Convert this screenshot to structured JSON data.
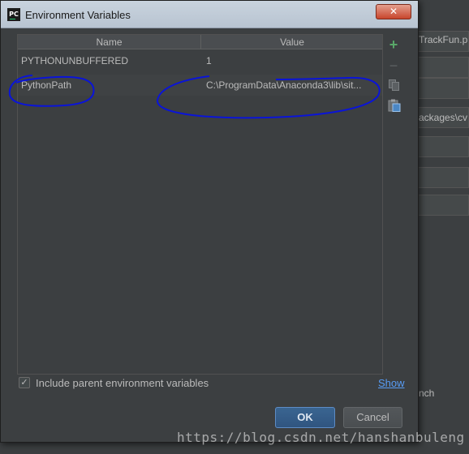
{
  "background_ide": {
    "fragments": [
      "TrackFun.p",
      "ackages\\cv",
      "nch"
    ]
  },
  "dialog": {
    "app_icon": "PC",
    "title": "Environment Variables",
    "close_label": "✕"
  },
  "table": {
    "columns": [
      "Name",
      "Value"
    ],
    "rows": [
      {
        "name": "PYTHONUNBUFFERED",
        "value": "1"
      },
      {
        "name": "PythonPath",
        "value": "C:\\ProgramData\\Anaconda3\\lib\\sit..."
      }
    ]
  },
  "toolbar": {
    "add_icon": "plus-icon",
    "add_label": "+",
    "remove_icon": "minus-icon",
    "remove_label": "−",
    "copy_icon": "copy-icon",
    "paste_icon": "paste-icon"
  },
  "footer": {
    "checkbox_checked": true,
    "checkbox_mark": "✓",
    "checkbox_label": "Include parent environment variables",
    "show_link": "Show",
    "ok_label": "OK",
    "cancel_label": "Cancel"
  },
  "watermark": "https://blog.csdn.net/hanshanbuleng",
  "colors": {
    "annotation_ink": "#0a14d8",
    "link": "#589df6",
    "accent_button": "#365f8c"
  }
}
